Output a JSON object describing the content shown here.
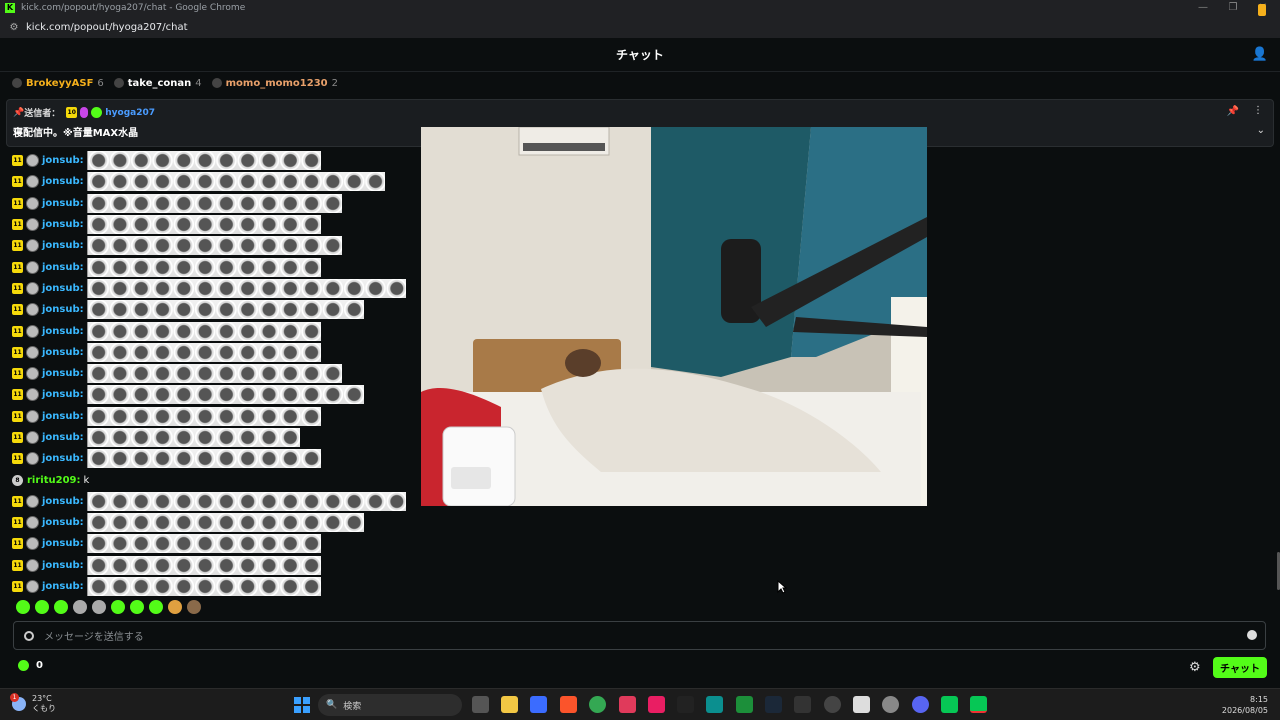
{
  "window": {
    "title": "kick.com/popout/hyoga207/chat - Google Chrome",
    "url": "kick.com/popout/hyoga207/chat"
  },
  "header": {
    "title": "チャット"
  },
  "leaderboard": [
    {
      "name": "BrokeyyASF",
      "count": "6",
      "color": "#f5b01c"
    },
    {
      "name": "take_conan",
      "count": "4",
      "color": "#ffffff"
    },
    {
      "name": "momo_momo1230",
      "count": "2",
      "color": "#e8a06a"
    }
  ],
  "pinned": {
    "sender_label": "送信者：",
    "sub_months": "10",
    "username": "hyoga207",
    "message": "寝配信中。※音量MAX水晶"
  },
  "messages": [
    {
      "type": "emote",
      "sub": "11",
      "user": "jonsub:",
      "emotes": 11
    },
    {
      "type": "emote",
      "sub": "11",
      "user": "jonsub:",
      "emotes": 14
    },
    {
      "type": "emote",
      "sub": "11",
      "user": "jonsub:",
      "emotes": 12
    },
    {
      "type": "emote",
      "sub": "11",
      "user": "jonsub:",
      "emotes": 11
    },
    {
      "type": "emote",
      "sub": "11",
      "user": "jonsub:",
      "emotes": 12
    },
    {
      "type": "emote",
      "sub": "11",
      "user": "jonsub:",
      "emotes": 11
    },
    {
      "type": "emote",
      "sub": "11",
      "user": "jonsub:",
      "emotes": 15
    },
    {
      "type": "emote",
      "sub": "11",
      "user": "jonsub:",
      "emotes": 13
    },
    {
      "type": "emote",
      "sub": "11",
      "user": "jonsub:",
      "emotes": 11
    },
    {
      "type": "emote",
      "sub": "11",
      "user": "jonsub:",
      "emotes": 11
    },
    {
      "type": "emote",
      "sub": "11",
      "user": "jonsub:",
      "emotes": 12
    },
    {
      "type": "emote",
      "sub": "11",
      "user": "jonsub:",
      "emotes": 13
    },
    {
      "type": "emote",
      "sub": "11",
      "user": "jonsub:",
      "emotes": 11
    },
    {
      "type": "emote",
      "sub": "11",
      "user": "jonsub:",
      "emotes": 10
    },
    {
      "type": "emote",
      "sub": "11",
      "user": "jonsub:",
      "emotes": 11
    },
    {
      "type": "text",
      "badge": "8",
      "user": "riritu209:",
      "text": "k"
    },
    {
      "type": "emote",
      "sub": "11",
      "user": "jonsub:",
      "emotes": 15
    },
    {
      "type": "emote",
      "sub": "11",
      "user": "jonsub:",
      "emotes": 13
    },
    {
      "type": "emote",
      "sub": "11",
      "user": "jonsub:",
      "emotes": 11
    },
    {
      "type": "emote",
      "sub": "11",
      "user": "jonsub:",
      "emotes": 11
    },
    {
      "type": "emote",
      "sub": "11",
      "user": "jonsub:",
      "emotes": 11
    }
  ],
  "input": {
    "placeholder": "メッセージを送信する"
  },
  "footer": {
    "points": "0",
    "chat_button": "チャット"
  },
  "taskbar": {
    "temp": "23°C",
    "weather": "くもり",
    "weather_badge": "1",
    "search_placeholder": "検索",
    "time": "8:15",
    "date": "2026/08/05"
  },
  "colors": {
    "accent": "#53fc18",
    "username": "#3ab8ff",
    "sub_badge": "#f5d90a"
  }
}
